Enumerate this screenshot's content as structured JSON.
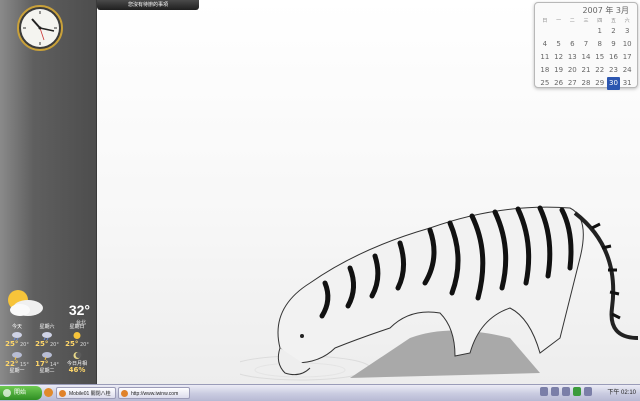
{
  "notice": "您沒有待辦的事項",
  "calendar": {
    "title": "2007 年 3月",
    "weekday_headers": [
      "日",
      "一",
      "二",
      "三",
      "四",
      "五",
      "六"
    ],
    "weeks": [
      [
        "",
        "",
        "",
        "",
        "1",
        "2",
        "3"
      ],
      [
        "4",
        "5",
        "6",
        "7",
        "8",
        "9",
        "10"
      ],
      [
        "11",
        "12",
        "13",
        "14",
        "15",
        "16",
        "17"
      ],
      [
        "18",
        "19",
        "20",
        "21",
        "22",
        "23",
        "24"
      ],
      [
        "25",
        "26",
        "27",
        "28",
        "29",
        "30",
        "31"
      ]
    ],
    "today": "30",
    "accent": "#2c56b0"
  },
  "weather": {
    "temp": "32°",
    "location": "台北",
    "forecast": [
      {
        "day": "今天",
        "hi": "25°",
        "lo": "20°"
      },
      {
        "day": "星期六",
        "hi": "25°",
        "lo": "20°"
      },
      {
        "day": "星期日",
        "hi": "25°",
        "lo": "20°"
      },
      {
        "day": "星期一",
        "hi": "22°",
        "lo": "15°"
      },
      {
        "day": "星期二",
        "hi": "17°",
        "lo": "14°"
      },
      {
        "day": "今日月相",
        "hi": "46%",
        "lo": ""
      }
    ]
  },
  "taskbar": {
    "start_label": "開始",
    "tasks": [
      "Mobile01 關閉八桂",
      "http://www.iwinw.com"
    ],
    "clock": "下午 02:10"
  },
  "colors": {
    "sidebar": "#5f5f5f",
    "start": "#3a9b2d",
    "taskbar": "#c9cbe0"
  }
}
